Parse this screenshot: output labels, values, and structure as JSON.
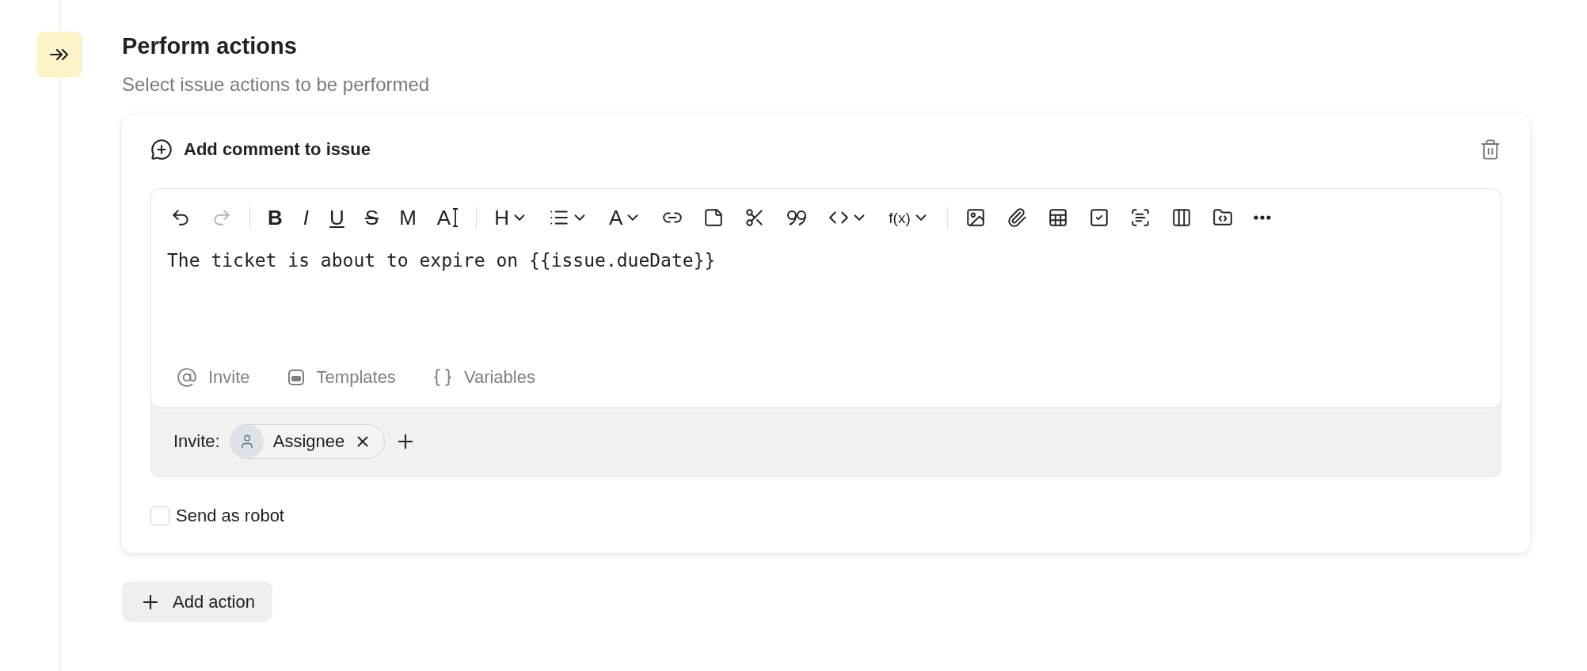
{
  "section": {
    "title": "Perform actions",
    "subtitle": "Select issue actions to be performed"
  },
  "action": {
    "title": "Add comment to issue",
    "toolbar": [
      {
        "kind": "undo",
        "disabled": false,
        "dropdown": false
      },
      {
        "kind": "redo",
        "disabled": true,
        "dropdown": false
      },
      {
        "kind": "separator"
      },
      {
        "kind": "bold",
        "label": "B",
        "disabled": false,
        "dropdown": false
      },
      {
        "kind": "italic",
        "label": "I",
        "disabled": false,
        "dropdown": false
      },
      {
        "kind": "underline",
        "label": "U",
        "disabled": false,
        "dropdown": false
      },
      {
        "kind": "strike",
        "label": "S",
        "disabled": false,
        "dropdown": false
      },
      {
        "kind": "mono",
        "label": "M",
        "disabled": false,
        "dropdown": false
      },
      {
        "kind": "typograf",
        "label": "A",
        "disabled": false,
        "dropdown": false
      },
      {
        "kind": "separator"
      },
      {
        "kind": "heading",
        "label": "H",
        "disabled": false,
        "dropdown": true
      },
      {
        "kind": "list",
        "disabled": false,
        "dropdown": true
      },
      {
        "kind": "color",
        "label": "A",
        "disabled": false,
        "dropdown": true
      },
      {
        "kind": "link",
        "disabled": false,
        "dropdown": false
      },
      {
        "kind": "note",
        "disabled": false,
        "dropdown": false
      },
      {
        "kind": "cut",
        "disabled": false,
        "dropdown": false
      },
      {
        "kind": "quote",
        "disabled": false,
        "dropdown": false
      },
      {
        "kind": "code",
        "disabled": false,
        "dropdown": true
      },
      {
        "kind": "formula",
        "label": "f(x)",
        "disabled": false,
        "dropdown": true
      },
      {
        "kind": "separator"
      },
      {
        "kind": "image",
        "disabled": false,
        "dropdown": false
      },
      {
        "kind": "attach",
        "disabled": false,
        "dropdown": false
      },
      {
        "kind": "table",
        "disabled": false,
        "dropdown": false
      },
      {
        "kind": "task",
        "disabled": false,
        "dropdown": false
      },
      {
        "kind": "scan",
        "disabled": false,
        "dropdown": false
      },
      {
        "kind": "columns",
        "disabled": false,
        "dropdown": false
      },
      {
        "kind": "embed",
        "disabled": false,
        "dropdown": false
      },
      {
        "kind": "more",
        "disabled": false,
        "dropdown": false
      }
    ],
    "text": "The ticket is about to expire on {{issue.dueDate}}",
    "footer": [
      {
        "kind": "invite",
        "label": "Invite"
      },
      {
        "kind": "templates",
        "label": "Templates"
      },
      {
        "kind": "variables",
        "label": "Variables"
      }
    ],
    "invite_label": "Invite:",
    "invitees": [
      {
        "name": "Assignee"
      }
    ],
    "send_as_robot": {
      "label": "Send as robot",
      "checked": false
    }
  },
  "add_action": "Add action"
}
